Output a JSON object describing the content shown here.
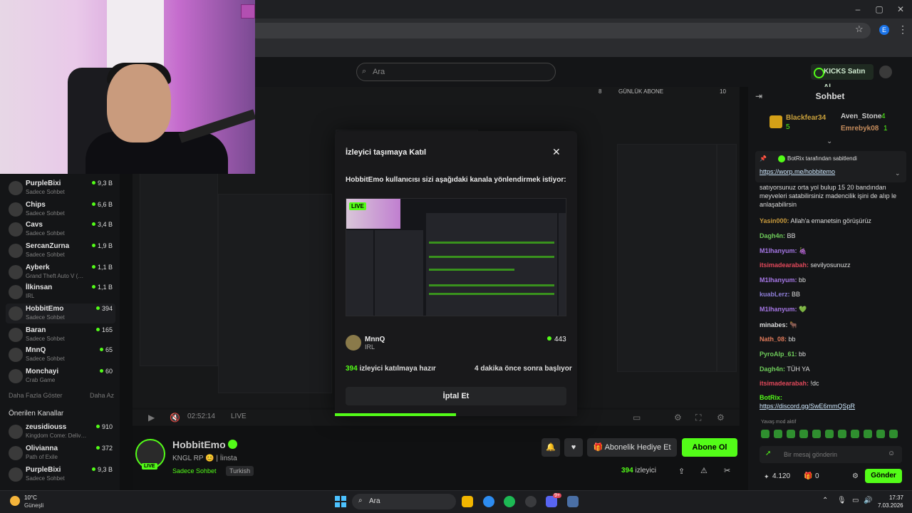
{
  "browser": {
    "profile_initial": "E"
  },
  "site": {
    "search_placeholder": "Ara",
    "kicks_label": "KICKS Satın Al"
  },
  "stats_bar": {
    "left_value": "8",
    "label": "GÜNLÜK ABONE",
    "right_value": "10"
  },
  "sidebar": {
    "channels": [
      {
        "name": "PurpleBixi",
        "sub": "Sadece Sohbet",
        "count": "9,3 B"
      },
      {
        "name": "Chips",
        "sub": "Sadece Sohbet",
        "count": "6,6 B"
      },
      {
        "name": "Cavs",
        "sub": "Sadece Sohbet",
        "count": "3,4 B"
      },
      {
        "name": "SercanZurna",
        "sub": "Sadece Sohbet",
        "count": "1,9 B"
      },
      {
        "name": "Ayberk",
        "sub": "Grand Theft Auto V (…",
        "count": "1,1 B"
      },
      {
        "name": "İlkinsan",
        "sub": "IRL",
        "count": "1,1 B"
      },
      {
        "name": "HobbitEmo",
        "sub": "Sadece Sohbet",
        "count": "394"
      },
      {
        "name": "Baran",
        "sub": "Sadece Sohbet",
        "count": "165"
      },
      {
        "name": "MnnQ",
        "sub": "Sadece Sohbet",
        "count": "65"
      },
      {
        "name": "Monchayi",
        "sub": "Crab Game",
        "count": "60"
      }
    ],
    "show_more": "Daha Fazla Göster",
    "show_less": "Daha Az",
    "recommended_title": "Önerilen Kanallar",
    "recommended": [
      {
        "name": "zeusidiouss",
        "sub": "Kingdom Come: Deliv…",
        "count": "910"
      },
      {
        "name": "Olivianna",
        "sub": "Path of Exile",
        "count": "372"
      },
      {
        "name": "PurpleBixi",
        "sub": "Sadece Sohbet",
        "count": "9,3 B"
      }
    ]
  },
  "player": {
    "time": "02:52:14",
    "live": "LIVE"
  },
  "channel": {
    "name": "HobbitEmo",
    "live_badge": "LIVE",
    "desc": "KNGL RP 😊 | İinsta",
    "category": "Sadece Sohbet",
    "language": "Turkish",
    "gift_button": "Abonelik Hediye Et",
    "subscribe_button": "Abone Ol",
    "viewers_num": "394",
    "viewers_label": "izleyici"
  },
  "chat": {
    "title": "Sohbet",
    "leaderboard": [
      {
        "name": "Blackfear34",
        "value": "5"
      },
      {
        "name": "Aven_Stone",
        "value": "4"
      },
      {
        "name": "Emrebyk08",
        "value": "1"
      }
    ],
    "pinned_by": "BotRix tarafından sabitlendi",
    "pinned_link": "https://worp.me/hobbitemo",
    "messages": [
      {
        "user": "",
        "text": "satıyorsunuz orta yol bulup 15 20 bandından meyveleri satabilirsiniz madencilik işini de alıp le anlaşabilirsin"
      },
      {
        "user": "Yasin000:",
        "text": "Allah'a emanetsin görüşürüz"
      },
      {
        "user": "Dagh4n:",
        "text": "BB"
      },
      {
        "user": "M1lhanyum:",
        "text": "🍇"
      },
      {
        "user": "itsimadearabah:",
        "text": "sevilyosunuzz"
      },
      {
        "user": "M1lhanyum:",
        "text": "bb"
      },
      {
        "user": "kuabLerz:",
        "text": "BB"
      },
      {
        "user": "M1lhanyum:",
        "text": "💚"
      },
      {
        "user": "minabes:",
        "text": "🐂"
      },
      {
        "user": "Nath_08:",
        "text": "bb"
      },
      {
        "user": "PyroAlp_61:",
        "text": "bb"
      },
      {
        "user": "Dagh4n:",
        "text": "TÜH YA"
      },
      {
        "user": "itsimadearabah:",
        "text": "!dc"
      },
      {
        "user": "BotRix:",
        "text": "https://discord.gg/SwE6mmQSpR"
      }
    ],
    "slow_mode": "Yavaş mod aktif",
    "input_placeholder": "Bir mesaj gönderin",
    "points": "4.120",
    "points2": "0",
    "send_button": "Gönder"
  },
  "modal": {
    "title": "İzleyici taşımaya Katıl",
    "message": "HobbitEmo kullanıcısı sizi aşağıdaki kanala yönlendirmek istiyor:",
    "preview_live": "LIVE",
    "target_name": "MnnQ",
    "target_category": "IRL",
    "target_viewers": "443",
    "ready_count": "394",
    "ready_text": "izleyici katılmaya hazır",
    "starts_text": "4 dakika önce sonra başlıyor",
    "cancel_button": "İptal Et",
    "progress": 0.5
  },
  "taskbar": {
    "weather_temp": "10°C",
    "weather_desc": "Güneşli",
    "search": "Ara",
    "discord_badge": "9+",
    "time": "17:37",
    "date": "7.03.2026"
  },
  "colors": {
    "accent": "#53fc18",
    "background": "#0f1011"
  }
}
